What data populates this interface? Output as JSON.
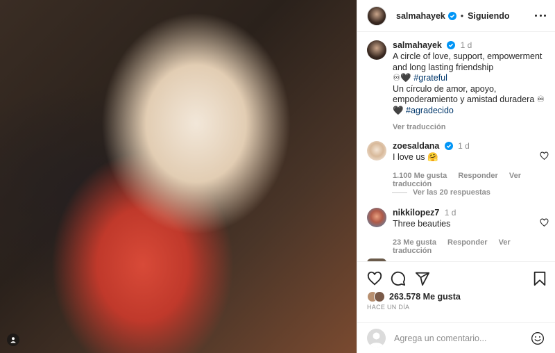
{
  "post": {
    "username": "salmahayek",
    "follow_status": "Siguiendo",
    "caption": {
      "time": "1 d",
      "line1": "A circle of love, support, empowerment",
      "line2": "and long lasting friendship",
      "line3_prefix": "♾🖤 ",
      "line3_hashtag": "#grateful",
      "line4": "Un círculo de amor, apoyo,",
      "line5": "empoderamiento y amistad duradera ♾",
      "line6_prefix": "🖤 ",
      "line6_hashtag": "#agradecido",
      "see_translation": "Ver traducción"
    },
    "comments": [
      {
        "username": "zoesaldana",
        "time": "1 d",
        "text": "I love us 🤗",
        "likes": "1.100 Me gusta",
        "reply": "Responder",
        "translate": "Ver traducción"
      },
      {
        "username": "nikkilopez7",
        "time": "1 d",
        "text": "Three beauties",
        "likes": "23 Me gusta",
        "reply": "Responder",
        "translate": "Ver traducción"
      }
    ],
    "view_replies": "Ver las 20 respuestas",
    "like_count": "263.578 Me gusta",
    "date": "HACE UN DÍA",
    "comment_placeholder": "Agrega un comentario..."
  },
  "colors": {
    "verified": "#0095f6",
    "hashtag": "#00376b",
    "muted": "#8e8e8e"
  },
  "icons": [
    "verified-badge-icon",
    "more-options-icon",
    "heart-icon",
    "comment-icon",
    "share-icon",
    "bookmark-icon",
    "emoji-icon",
    "user-tag-icon"
  ]
}
